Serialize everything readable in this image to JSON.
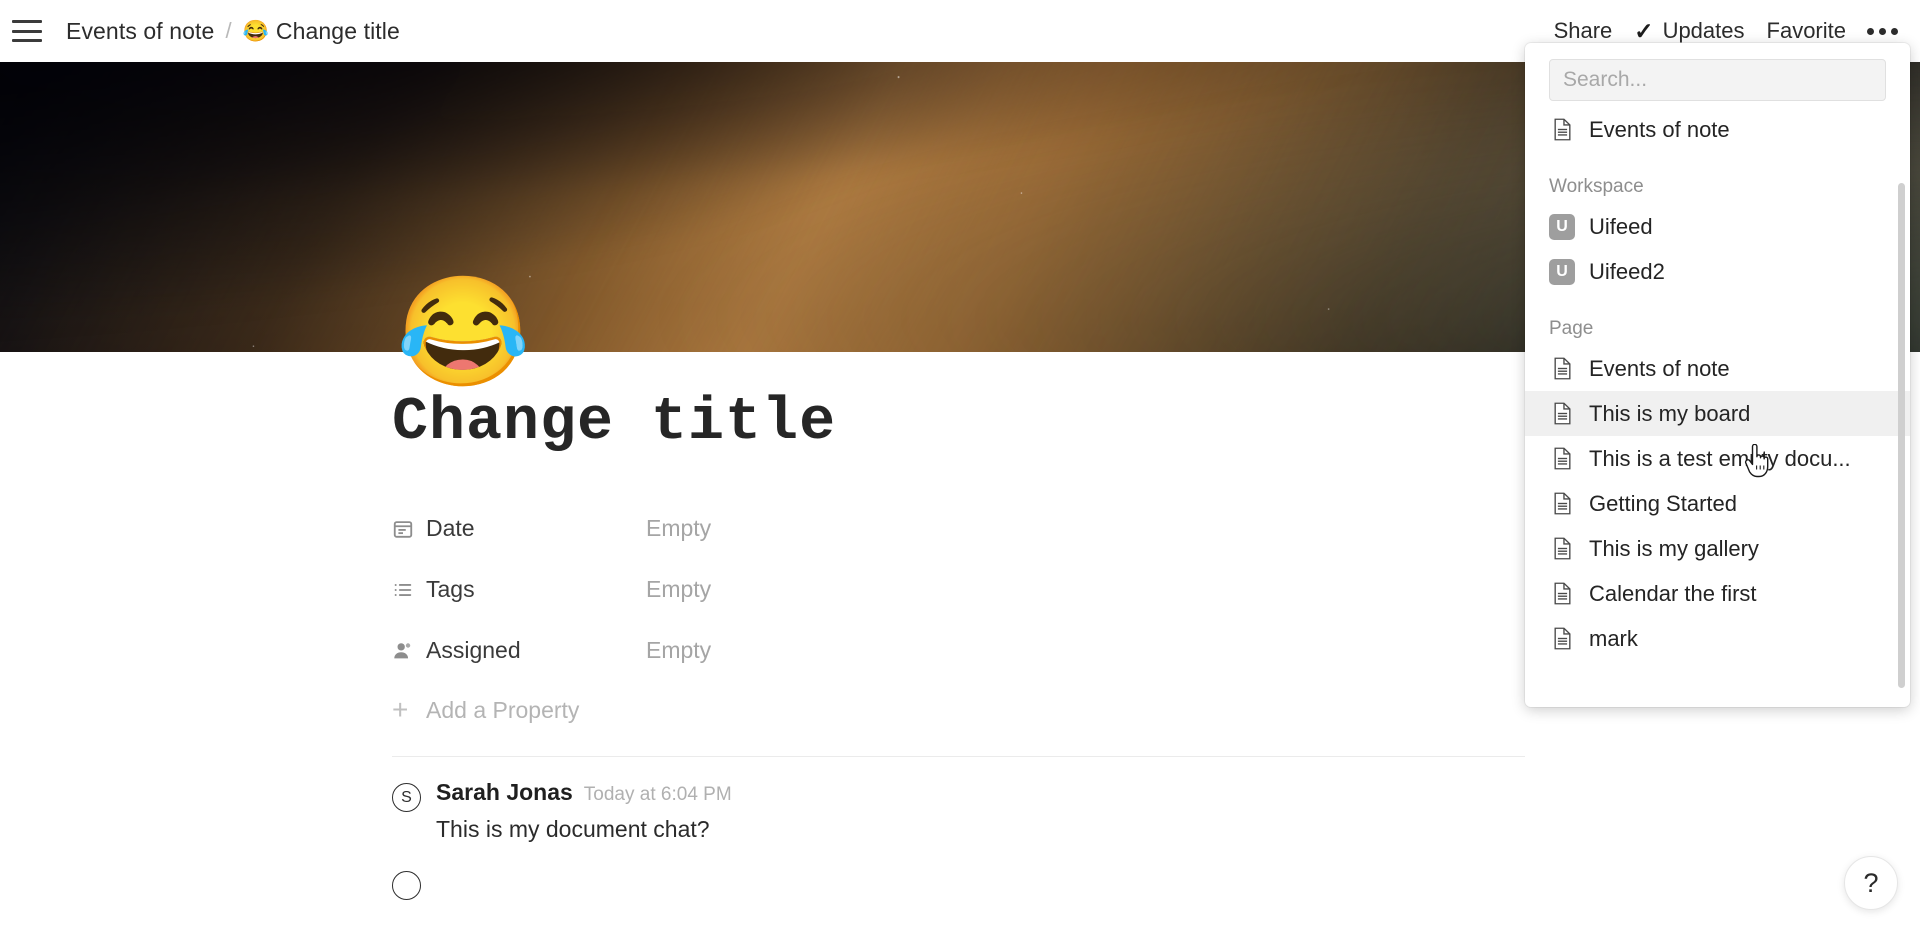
{
  "topbar": {
    "menu_icon": "hamburger-icon",
    "breadcrumb": {
      "parent": "Events of note",
      "separator": "/",
      "current_emoji": "😂",
      "current": "Change title"
    },
    "actions": {
      "share": "Share",
      "updates": "Updates",
      "updates_check": "✓",
      "favorite": "Favorite",
      "more": "•••"
    }
  },
  "cover": {
    "alt": "space nebula cover image",
    "colors": {
      "dark": "#05060c",
      "orange": "#d6964e",
      "green": "#60705c"
    }
  },
  "page": {
    "emoji": "😂",
    "title": "Change title",
    "properties": [
      {
        "icon": "calendar-icon",
        "label": "Date",
        "value": "Empty"
      },
      {
        "icon": "list-icon",
        "label": "Tags",
        "value": "Empty"
      },
      {
        "icon": "person-icon",
        "label": "Assigned",
        "value": "Empty"
      }
    ],
    "add_property_label": "Add a Property",
    "add_property_icon": "plus-icon"
  },
  "comments": [
    {
      "avatar_initial": "S",
      "author": "Sarah Jonas",
      "time": "Today at 6:04 PM",
      "text": "This is my document chat?"
    },
    {
      "avatar_initial": "",
      "author": "",
      "time": "",
      "text": ""
    }
  ],
  "help": {
    "icon": "question-mark-icon",
    "label": "?"
  },
  "dropdown": {
    "search": {
      "placeholder": "Search...",
      "value": ""
    },
    "recent": [
      {
        "icon": "document-icon",
        "label": "Events of note"
      }
    ],
    "sections": [
      {
        "title": "Workspace",
        "items": [
          {
            "icon": "workspace-icon",
            "badge": "U",
            "label": "Uifeed"
          },
          {
            "icon": "workspace-icon",
            "badge": "U",
            "label": "Uifeed2"
          }
        ]
      },
      {
        "title": "Page",
        "items": [
          {
            "icon": "document-icon",
            "label": "Events of note",
            "hovered": false
          },
          {
            "icon": "document-icon",
            "label": "This is my board",
            "hovered": true
          },
          {
            "icon": "document-icon",
            "label": "This is a test empty docu...",
            "hovered": false
          },
          {
            "icon": "document-icon",
            "label": "Getting Started",
            "hovered": false
          },
          {
            "icon": "document-icon",
            "label": "This is my gallery",
            "hovered": false
          },
          {
            "icon": "document-icon",
            "label": "Calendar the first",
            "hovered": false
          },
          {
            "icon": "document-icon",
            "label": "mark",
            "hovered": false
          }
        ]
      }
    ],
    "scrollbar": "vertical-scrollbar"
  }
}
